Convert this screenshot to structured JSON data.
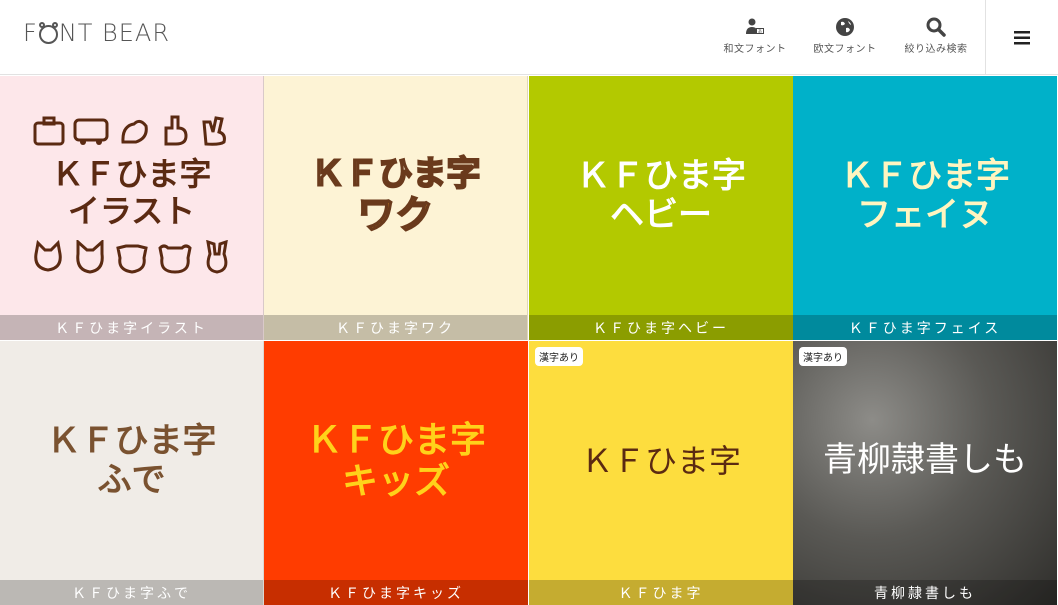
{
  "brand": {
    "name_prefix": "F",
    "name_suffix": "NT BEAR"
  },
  "nav": [
    {
      "label": "和文フォント",
      "icon": "person-book-icon"
    },
    {
      "label": "欧文フォント",
      "icon": "globe-icon"
    },
    {
      "label": "絞り込み検索",
      "icon": "search-icon"
    }
  ],
  "menu": {
    "icon": "hamburger-menu-icon"
  },
  "fonts": [
    {
      "caption": "ＫＦひま字イラスト",
      "art_line1": "ＫＦひま字",
      "art_line2": "イラスト",
      "badge": ""
    },
    {
      "caption": "ＫＦひま字ワク",
      "art_line1": "ＫＦひま字",
      "art_line2": "ワク",
      "badge": ""
    },
    {
      "caption": "ＫＦひま字ヘビー",
      "art_line1": "ＫＦひま字",
      "art_line2": "ヘビー",
      "badge": ""
    },
    {
      "caption": "ＫＦひま字フェイス",
      "art_line1": "ＫＦひま字",
      "art_line2": "フェイヌ",
      "badge": ""
    },
    {
      "caption": "ＫＦひま字ふで",
      "art_line1": "ＫＦひま字",
      "art_line2": "ふで",
      "badge": ""
    },
    {
      "caption": "ＫＦひま字キッズ",
      "art_line1": "ＫＦひま字",
      "art_line2": "キッズ",
      "badge": ""
    },
    {
      "caption": "ＫＦひま字",
      "art_line1": "ＫＦひま字",
      "art_line2": "",
      "badge": "漢字あり"
    },
    {
      "caption": "青柳隷書しも",
      "art_line1": "青柳隷書しも",
      "art_line2": "",
      "badge": "漢字あり"
    }
  ],
  "colors": {
    "accent_text": "#5b2a12",
    "tile_3": "#b3c900",
    "tile_4": "#00b1c9",
    "tile_6": "#ff3c00",
    "tile_7": "#fddd3e"
  }
}
